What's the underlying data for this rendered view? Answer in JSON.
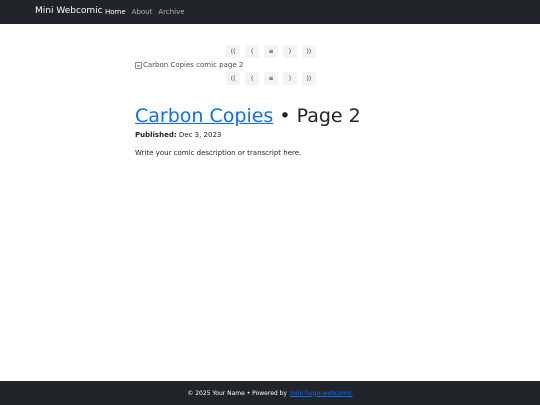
{
  "navbar": {
    "brand": "Mini Webcomic",
    "links": [
      "Home",
      "About",
      "Archive"
    ]
  },
  "comic_nav": {
    "first": "⟨⟨",
    "prev": "⟨",
    "archive": "≡",
    "next": "⟩",
    "last": "⟩⟩"
  },
  "comic": {
    "image_alt": "Carbon Copies comic page 2",
    "series_title": "Carbon Copies",
    "page_suffix": "• Page 2",
    "published_label": "Published:",
    "published_date": "Dec 3, 2023",
    "description": "Write your comic description or transcript here."
  },
  "footer": {
    "text": "© 2025 Your Name • Powered by",
    "link": "mini-hugo-webcomic"
  },
  "colors": {
    "navbar_bg": "#212529",
    "link": "#0d6efd",
    "button_bg": "#f1f3f5"
  }
}
